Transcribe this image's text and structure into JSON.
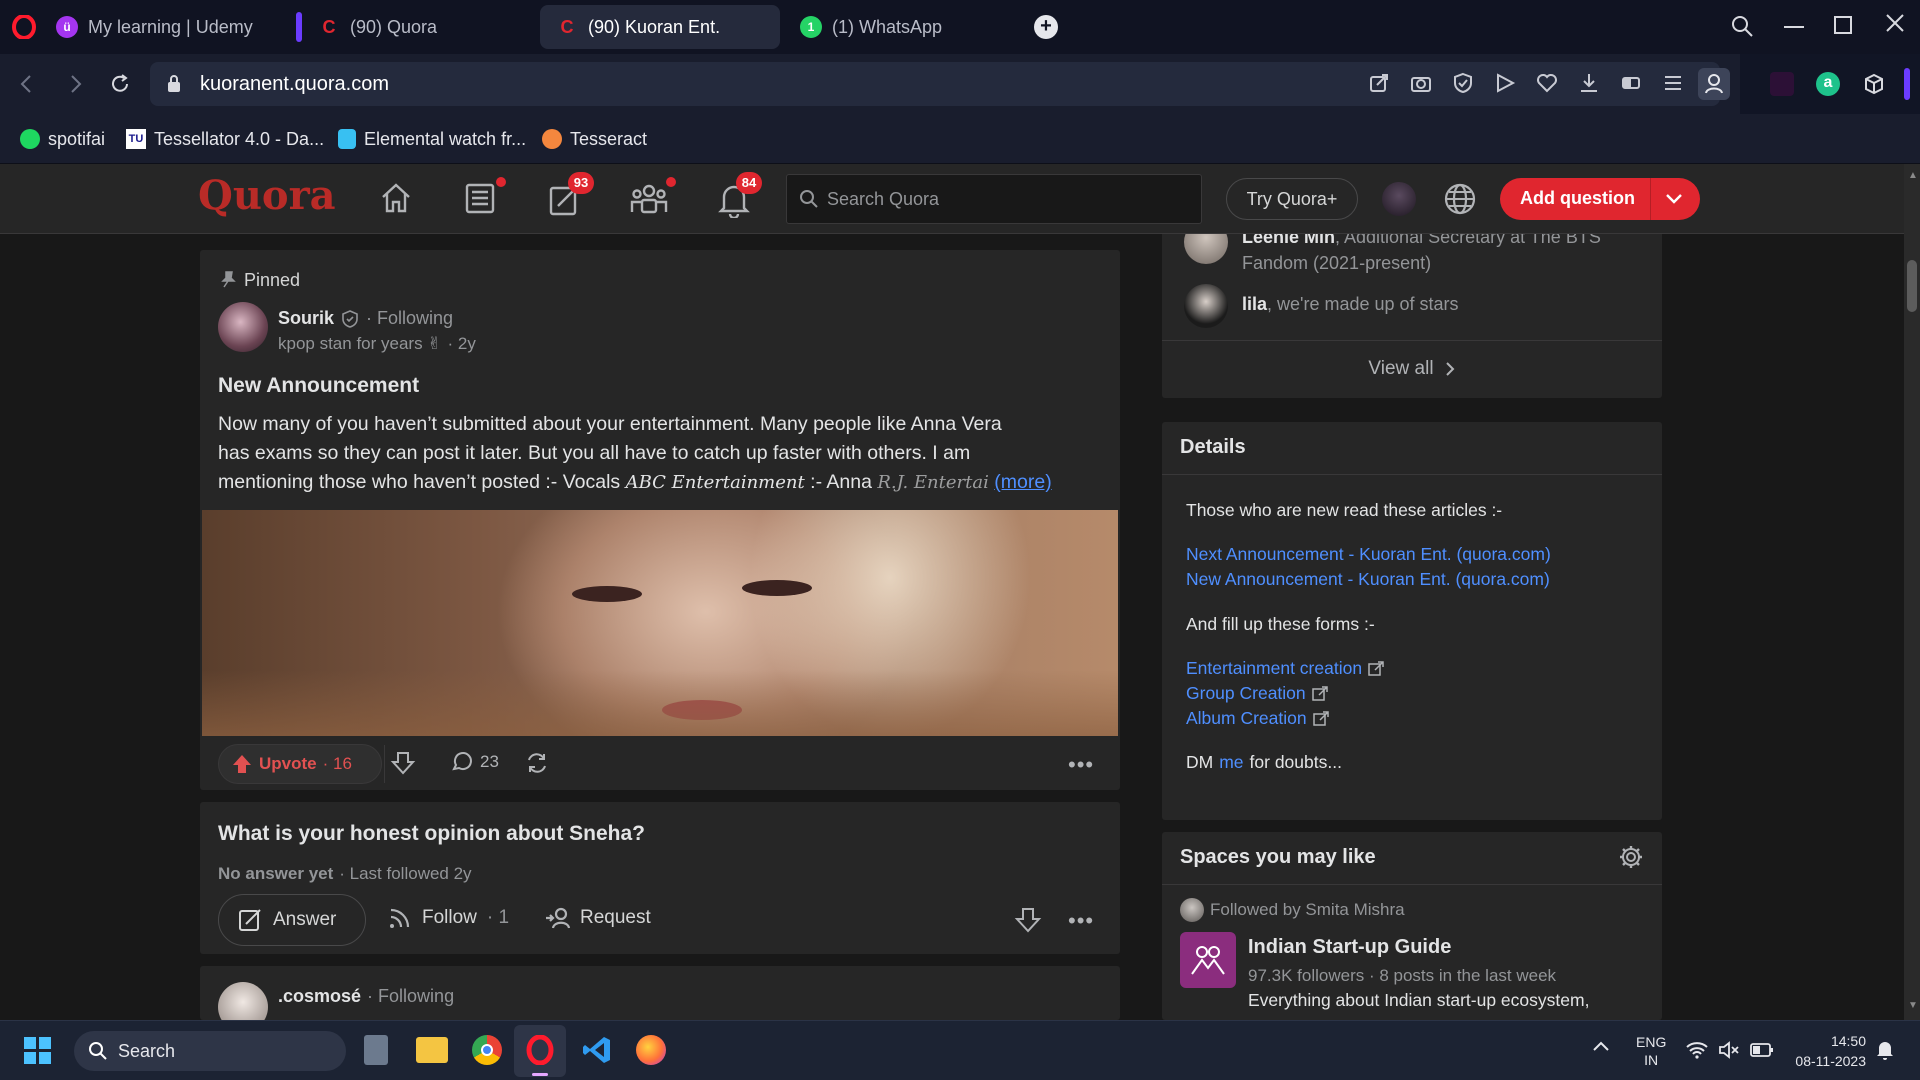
{
  "browser": {
    "tabs": [
      {
        "title": "My learning | Udemy",
        "icon": "udemy-icon"
      },
      {
        "title": "(90) Quora",
        "icon": "quora-icon"
      },
      {
        "title": "(90) Kuoran Ent.",
        "icon": "quora-icon"
      },
      {
        "title": "(1) WhatsApp",
        "icon": "whatsapp-icon"
      }
    ],
    "url": "kuoranent.quora.com",
    "bookmarks": [
      {
        "label": "spotifai",
        "icon": "spotify-icon"
      },
      {
        "label": "Tessellator 4.0 - Da...",
        "icon": "tessellator-icon"
      },
      {
        "label": "Elemental watch fr...",
        "icon": "elemental-icon"
      },
      {
        "label": "Tesseract",
        "icon": "tesseract-icon"
      }
    ]
  },
  "quora_header": {
    "logo": "Quora",
    "answer_badge": "93",
    "notifications_badge": "84",
    "search_placeholder": "Search Quora",
    "try_plus": "Try Quora+",
    "add_question": "Add question"
  },
  "feed": {
    "pinned_post": {
      "pinned_label": "Pinned",
      "author": "Sourik",
      "following": "· Following",
      "credential": "kpop stan for years ✌",
      "time": "· 2y",
      "title": "New Announcement",
      "body_line1": "Now many of you haven’t submitted about your entertainment. Many people like Anna Vera",
      "body_line2": "has exams so they can post it later. But you all have to catch up faster with others. I am",
      "body_line3_plain": "mentioning those who haven’t posted :- Vocals ",
      "body_line3_italic1": "ABC Entertainment",
      "body_line3_mid": " :- Anna ",
      "body_line3_italic2": "R.J. Entertai",
      "more": "(more)",
      "upvote_label": "Upvote",
      "upvote_count": "· 16",
      "comments": "23"
    },
    "question_post": {
      "title": "What is your honest opinion about Sneha?",
      "no_answer": "No answer yet",
      "last_followed": "· Last followed 2y",
      "answer": "Answer",
      "follow": "Follow",
      "follow_count": "· 1",
      "request": "Request"
    },
    "next_post": {
      "author": ".cosmosé",
      "following": "· Following"
    }
  },
  "sidebar": {
    "followers": [
      {
        "name": "Leenie Min",
        "bio_line1": ", Additional Secretary at The BTS",
        "bio_line2": "Fandom (2021-present)"
      },
      {
        "name": "lila",
        "bio_line1": ", we're made up of stars"
      }
    ],
    "view_all": "View all",
    "details": {
      "heading": "Details",
      "intro": "Those who are new read these articles :-",
      "links": [
        "Next Announcement - Kuoran Ent. (quora.com)",
        "New Announcement - Kuoran Ent. (quora.com)"
      ],
      "forms_intro": "And fill up these forms :-",
      "forms": [
        "Entertainment creation",
        "Group Creation",
        "Album Creation"
      ],
      "dm_prefix": "DM",
      "dm_link": "me",
      "dm_suffix": "for doubts..."
    },
    "spaces": {
      "heading": "Spaces you may like",
      "followed_by": "Followed by Smita Mishra",
      "space_name": "Indian Start-up Guide",
      "space_meta": "97.3K followers · 8 posts in the last week",
      "space_desc": "Everything about Indian start-up ecosystem,"
    }
  },
  "taskbar": {
    "search": "Search",
    "lang_line1": "ENG",
    "lang_line2": "IN",
    "time": "14:50",
    "date": "08-11-2023"
  },
  "colors": {
    "quora_red": "#b92b27",
    "add_question_red": "#e0262f",
    "link_blue": "#4f8fff",
    "upvote_red": "#e25151"
  }
}
